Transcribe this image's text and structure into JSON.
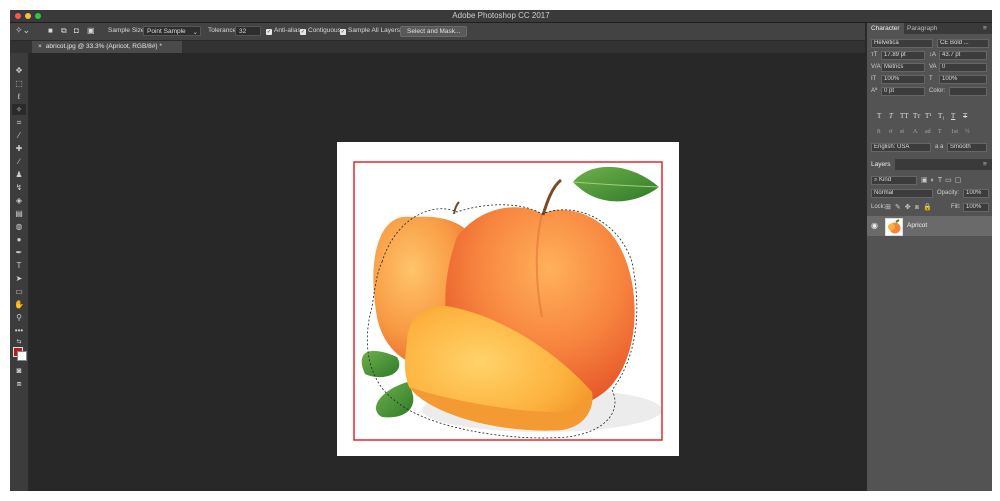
{
  "app": {
    "title": "Adobe Photoshop CC 2017",
    "colors": {
      "close": "#fc5753",
      "minimize": "#fdbc40",
      "zoom": "#33c748",
      "selection_box": "#e8262a"
    }
  },
  "options_bar": {
    "tool_icon": "magic-wand-icon",
    "sample_size_label": "Sample Size:",
    "sample_size_value": "Point Sample",
    "tolerance_label": "Tolerance:",
    "tolerance_value": "32",
    "anti_alias": "Anti-alias",
    "contiguous": "Contiguous",
    "sample_all_layers": "Sample All Layers",
    "select_and_mask": "Select and Mask..."
  },
  "document_tab": {
    "label": "abricot.jpg @ 33.3% (Apricot, RGB/8#) *",
    "close": "×"
  },
  "character_panel": {
    "tabs": [
      "Character",
      "Paragraph"
    ],
    "font_family": "Helvetica",
    "font_style": "CE Bold ...",
    "font_size": "17.89 pt",
    "leading": "43.7 pt",
    "kerning": "Metrics",
    "tracking": "0",
    "vertical_scale": "100%",
    "horizontal_scale": "100%",
    "baseline_shift": "0 pt",
    "color_label": "Color:",
    "styles_row1": [
      "T",
      "T",
      "TT",
      "Tт",
      "T¹",
      "T₁",
      "T",
      "T"
    ],
    "styles_row2": [
      "fi",
      "ơ",
      "st",
      "A",
      "ad",
      "T",
      "1st",
      "½"
    ],
    "language": "English: USA",
    "antialias": "Smooth",
    "aa_prefix": "a a"
  },
  "layers_panel": {
    "title": "Layers",
    "filter": "Kind",
    "blend_mode": "Normal",
    "opacity_label": "Opacity:",
    "opacity_value": "100%",
    "lock_label": "Lock:",
    "fill_label": "Fill:",
    "fill_value": "100%",
    "layer_name": "Apricot"
  }
}
